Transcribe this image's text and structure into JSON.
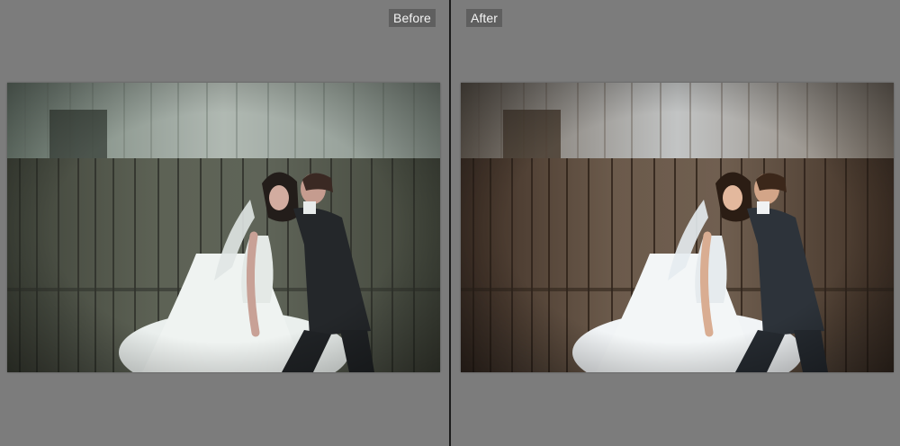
{
  "compare_view": {
    "before_label": "Before",
    "after_label": "After"
  },
  "colors": {
    "background": "#7c7c7c",
    "divider": "#1b1b1b",
    "label_bg": "#5f5f5f",
    "label_text": "#f4f4f4",
    "before_tone": "#5e6a5f",
    "after_tone": "#6a5a4c"
  },
  "icons": {
    "before_photo": "photo-image",
    "after_photo": "photo-image"
  }
}
